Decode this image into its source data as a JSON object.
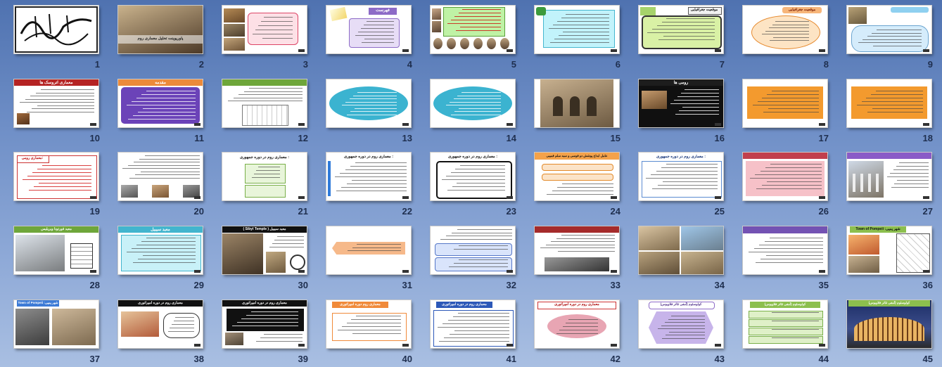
{
  "slides": [
    {
      "n": "1",
      "kind": "calligraphy"
    },
    {
      "n": "2",
      "kind": "books",
      "title": "پاورپوینت تحلیل معماری روم"
    },
    {
      "n": "3",
      "kind": "photos-pink"
    },
    {
      "n": "4",
      "kind": "purple-list",
      "title": "فهرست"
    },
    {
      "n": "5",
      "kind": "portraits"
    },
    {
      "n": "6",
      "kind": "cyan-text"
    },
    {
      "n": "7",
      "kind": "map-text",
      "title": "موقعیت جغرافیایی"
    },
    {
      "n": "8",
      "kind": "orange-ellipse",
      "title": "موقعیت جغرافیایی"
    },
    {
      "n": "9",
      "kind": "ruins-blue"
    },
    {
      "n": "10",
      "kind": "red-text",
      "title": "معماری اتروسک ها"
    },
    {
      "n": "11",
      "kind": "purple-text",
      "title": "مقدمه"
    },
    {
      "n": "12",
      "kind": "green-plan"
    },
    {
      "n": "13",
      "kind": "teal-ellipse"
    },
    {
      "n": "14",
      "kind": "teal-ellipse"
    },
    {
      "n": "15",
      "kind": "arch-photo"
    },
    {
      "n": "16",
      "kind": "black-photo",
      "title": "رومی ها"
    },
    {
      "n": "17",
      "kind": "orange-text"
    },
    {
      "n": "18",
      "kind": "orange-text"
    },
    {
      "n": "19",
      "kind": "red-frame",
      "title": "معماری رومی:"
    },
    {
      "n": "20",
      "kind": "text-photos"
    },
    {
      "n": "21",
      "kind": "green-small",
      "title": "معماری روم در دوره جمهوری :"
    },
    {
      "n": "22",
      "kind": "blue-text",
      "title": "معماری روم در دوره جمهوری :"
    },
    {
      "n": "23",
      "kind": "black-frame",
      "title": "معماری روم در دوره جمهوری :"
    },
    {
      "n": "24",
      "kind": "orange-rows",
      "title": "عامل ابداع پوشش دو قوسی و سبه سلم قمیبی"
    },
    {
      "n": "25",
      "kind": "blue-border",
      "title": "معماری روم در دوره جمهوری :"
    },
    {
      "n": "26",
      "kind": "pink-text"
    },
    {
      "n": "27",
      "kind": "temple-purple"
    },
    {
      "n": "28",
      "kind": "temple-plan",
      "title": "معبد فورتونا ویریلیس"
    },
    {
      "n": "29",
      "kind": "cyan-border",
      "title": "معبد سیبیل"
    },
    {
      "n": "30",
      "kind": "sibyl",
      "title": "( Sibyl Temple ) معبد سیبیل"
    },
    {
      "n": "31",
      "kind": "orange-arrow"
    },
    {
      "n": "32",
      "kind": "blue-blocks"
    },
    {
      "n": "33",
      "kind": "red-bar-photo"
    },
    {
      "n": "34",
      "kind": "photo-grid"
    },
    {
      "n": "35",
      "kind": "purple-bar-text"
    },
    {
      "n": "36",
      "kind": "pompeii",
      "title": "Town of Pompeii :شهر پمپی"
    },
    {
      "n": "37",
      "kind": "pompeii-photos",
      "title": "Town of Pompeii :شهر پمپی"
    },
    {
      "n": "38",
      "kind": "black-bar-house",
      "title": "معماری روم در دوره امپراتوری"
    },
    {
      "n": "39",
      "kind": "black-bar-box",
      "title": "معماری روم در دوره امپراتوری"
    },
    {
      "n": "40",
      "kind": "orange-bar",
      "title": "معماری روم دوره امپراتوری"
    },
    {
      "n": "41",
      "kind": "blue-bar",
      "title": "معماری روم در دوره امپراتوری"
    },
    {
      "n": "42",
      "kind": "pink-ellipse",
      "title": "معماری روم در دوره امپراتوری"
    },
    {
      "n": "43",
      "kind": "purple-hex",
      "title": "کولوسئوم (آمفی تئاتر فلاویوس)"
    },
    {
      "n": "44",
      "kind": "green-rows",
      "title": "کولوسئوم (آمفی تئاتر فلاویوس)"
    },
    {
      "n": "45",
      "kind": "colosseum",
      "title": "کولوسئوم (آمفی تئاتر فلاویوس)"
    }
  ]
}
